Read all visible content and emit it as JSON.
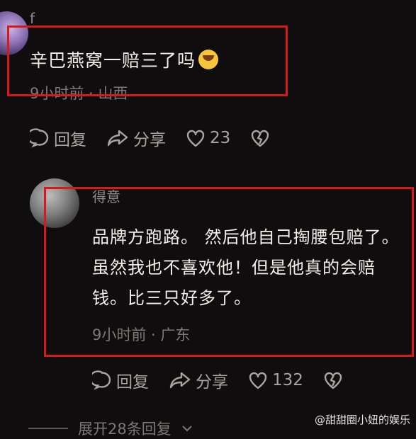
{
  "comment": {
    "username": "f_",
    "text": "辛巴燕窝一赔三了吗",
    "time": "9小时前",
    "location": "山西",
    "reply_label": "回复",
    "share_label": "分享",
    "likes": "23"
  },
  "reply": {
    "username": "得意",
    "text": "品牌方跑路。 然后他自己掏腰包赔了。 虽然我也不喜欢他！但是他真的会赔钱。比三只好多了。",
    "time": "9小时前",
    "location": "广东",
    "reply_label": "回复",
    "share_label": "分享",
    "likes": "132"
  },
  "expand_label": "展开28条回复",
  "watermark": "@甜甜圈小妞的娱乐",
  "icons": [
    "comment-icon",
    "share-icon",
    "heart-icon",
    "dislike-heart-icon",
    "laughing-emoji-icon",
    "chevron-down-icon"
  ],
  "colors": {
    "highlight_box": "#d61a1a",
    "background": "#0f0d0d"
  }
}
